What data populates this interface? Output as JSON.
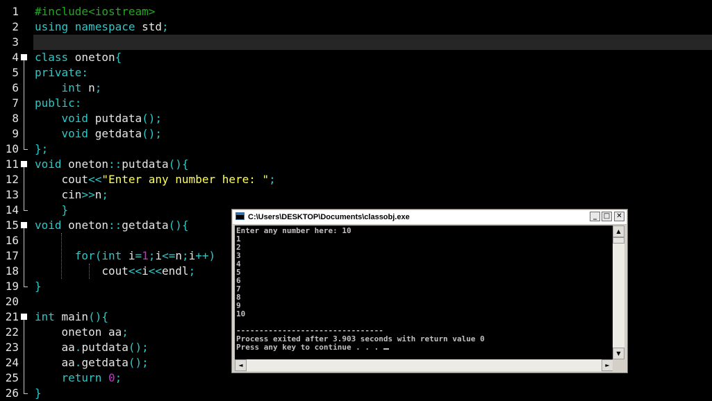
{
  "editor": {
    "line_numbers": [
      "1",
      "2",
      "3",
      "4",
      "5",
      "6",
      "7",
      "8",
      "9",
      "10",
      "11",
      "12",
      "13",
      "14",
      "15",
      "16",
      "17",
      "18",
      "19",
      "20",
      "21",
      "22",
      "23",
      "24",
      "25",
      "26"
    ],
    "colors": {
      "preprocessor": "#22a822",
      "keyword": "#2cc8c8",
      "string": "#ffff55",
      "number": "#c832c8",
      "text": "#e6e6e6"
    },
    "lines": [
      [
        {
          "c": "pp",
          "t": "#include<iostream>"
        }
      ],
      [
        {
          "c": "kw",
          "t": "using namespace "
        },
        {
          "c": "id",
          "t": "std"
        },
        {
          "c": "pn",
          "t": ";"
        }
      ],
      [],
      [
        {
          "c": "kw",
          "t": "class "
        },
        {
          "c": "id",
          "t": "oneton"
        },
        {
          "c": "pn",
          "t": "{"
        }
      ],
      [
        {
          "c": "kw",
          "t": "private:"
        }
      ],
      [
        {
          "c": "id",
          "t": "    "
        },
        {
          "c": "kw",
          "t": "int "
        },
        {
          "c": "id",
          "t": "n"
        },
        {
          "c": "pn",
          "t": ";"
        }
      ],
      [
        {
          "c": "kw",
          "t": "public:"
        }
      ],
      [
        {
          "c": "id",
          "t": "    "
        },
        {
          "c": "kw",
          "t": "void "
        },
        {
          "c": "id",
          "t": "putdata"
        },
        {
          "c": "pn",
          "t": "();"
        }
      ],
      [
        {
          "c": "id",
          "t": "    "
        },
        {
          "c": "kw",
          "t": "void "
        },
        {
          "c": "id",
          "t": "getdata"
        },
        {
          "c": "pn",
          "t": "();"
        }
      ],
      [
        {
          "c": "pn",
          "t": "};"
        }
      ],
      [
        {
          "c": "kw",
          "t": "void "
        },
        {
          "c": "id",
          "t": "oneton"
        },
        {
          "c": "pn",
          "t": "::"
        },
        {
          "c": "id",
          "t": "putdata"
        },
        {
          "c": "pn",
          "t": "(){"
        }
      ],
      [
        {
          "c": "id",
          "t": "    cout"
        },
        {
          "c": "pn",
          "t": "<<"
        },
        {
          "c": "str",
          "t": "\"Enter any number here: \""
        },
        {
          "c": "pn",
          "t": ";"
        }
      ],
      [
        {
          "c": "id",
          "t": "    cin"
        },
        {
          "c": "pn",
          "t": ">>"
        },
        {
          "c": "id",
          "t": "n"
        },
        {
          "c": "pn",
          "t": ";"
        }
      ],
      [
        {
          "c": "id",
          "t": "    "
        },
        {
          "c": "pn",
          "t": "}"
        }
      ],
      [
        {
          "c": "kw",
          "t": "void "
        },
        {
          "c": "id",
          "t": "oneton"
        },
        {
          "c": "pn",
          "t": "::"
        },
        {
          "c": "id",
          "t": "getdata"
        },
        {
          "c": "pn",
          "t": "(){"
        }
      ],
      [],
      [
        {
          "c": "id",
          "t": "      "
        },
        {
          "c": "kw",
          "t": "for"
        },
        {
          "c": "pn",
          "t": "("
        },
        {
          "c": "kw",
          "t": "int "
        },
        {
          "c": "id",
          "t": "i"
        },
        {
          "c": "pn",
          "t": "="
        },
        {
          "c": "num",
          "t": "1"
        },
        {
          "c": "pn",
          "t": ";"
        },
        {
          "c": "id",
          "t": "i"
        },
        {
          "c": "pn",
          "t": "<="
        },
        {
          "c": "id",
          "t": "n"
        },
        {
          "c": "pn",
          "t": ";"
        },
        {
          "c": "id",
          "t": "i"
        },
        {
          "c": "pn",
          "t": "++)"
        }
      ],
      [
        {
          "c": "id",
          "t": "          cout"
        },
        {
          "c": "pn",
          "t": "<<"
        },
        {
          "c": "id",
          "t": "i"
        },
        {
          "c": "pn",
          "t": "<<"
        },
        {
          "c": "id",
          "t": "endl"
        },
        {
          "c": "pn",
          "t": ";"
        }
      ],
      [
        {
          "c": "pn",
          "t": "}"
        }
      ],
      [],
      [
        {
          "c": "kw",
          "t": "int "
        },
        {
          "c": "id",
          "t": "main"
        },
        {
          "c": "pn",
          "t": "(){"
        }
      ],
      [
        {
          "c": "id",
          "t": "    oneton aa"
        },
        {
          "c": "pn",
          "t": ";"
        }
      ],
      [
        {
          "c": "id",
          "t": "    aa"
        },
        {
          "c": "pn",
          "t": "."
        },
        {
          "c": "id",
          "t": "putdata"
        },
        {
          "c": "pn",
          "t": "();"
        }
      ],
      [
        {
          "c": "id",
          "t": "    aa"
        },
        {
          "c": "pn",
          "t": "."
        },
        {
          "c": "id",
          "t": "getdata"
        },
        {
          "c": "pn",
          "t": "();"
        }
      ],
      [
        {
          "c": "id",
          "t": "    "
        },
        {
          "c": "kw",
          "t": "return "
        },
        {
          "c": "num",
          "t": "0"
        },
        {
          "c": "pn",
          "t": ";"
        }
      ],
      [
        {
          "c": "pn",
          "t": "}"
        }
      ]
    ]
  },
  "console": {
    "title": "C:\\Users\\DESKTOP\\Documents\\classobj.exe",
    "buttons": {
      "minimize": "_",
      "maximize": "□",
      "close": "✕"
    },
    "scroll_up": "▲",
    "scroll_down": "▼",
    "scroll_left": "◄",
    "scroll_right": "►",
    "output": [
      "Enter any number here: 10",
      "1",
      "2",
      "3",
      "4",
      "5",
      "6",
      "7",
      "8",
      "9",
      "10",
      "",
      "--------------------------------",
      "Process exited after 3.903 seconds with return value 0",
      "Press any key to continue . . . "
    ]
  }
}
